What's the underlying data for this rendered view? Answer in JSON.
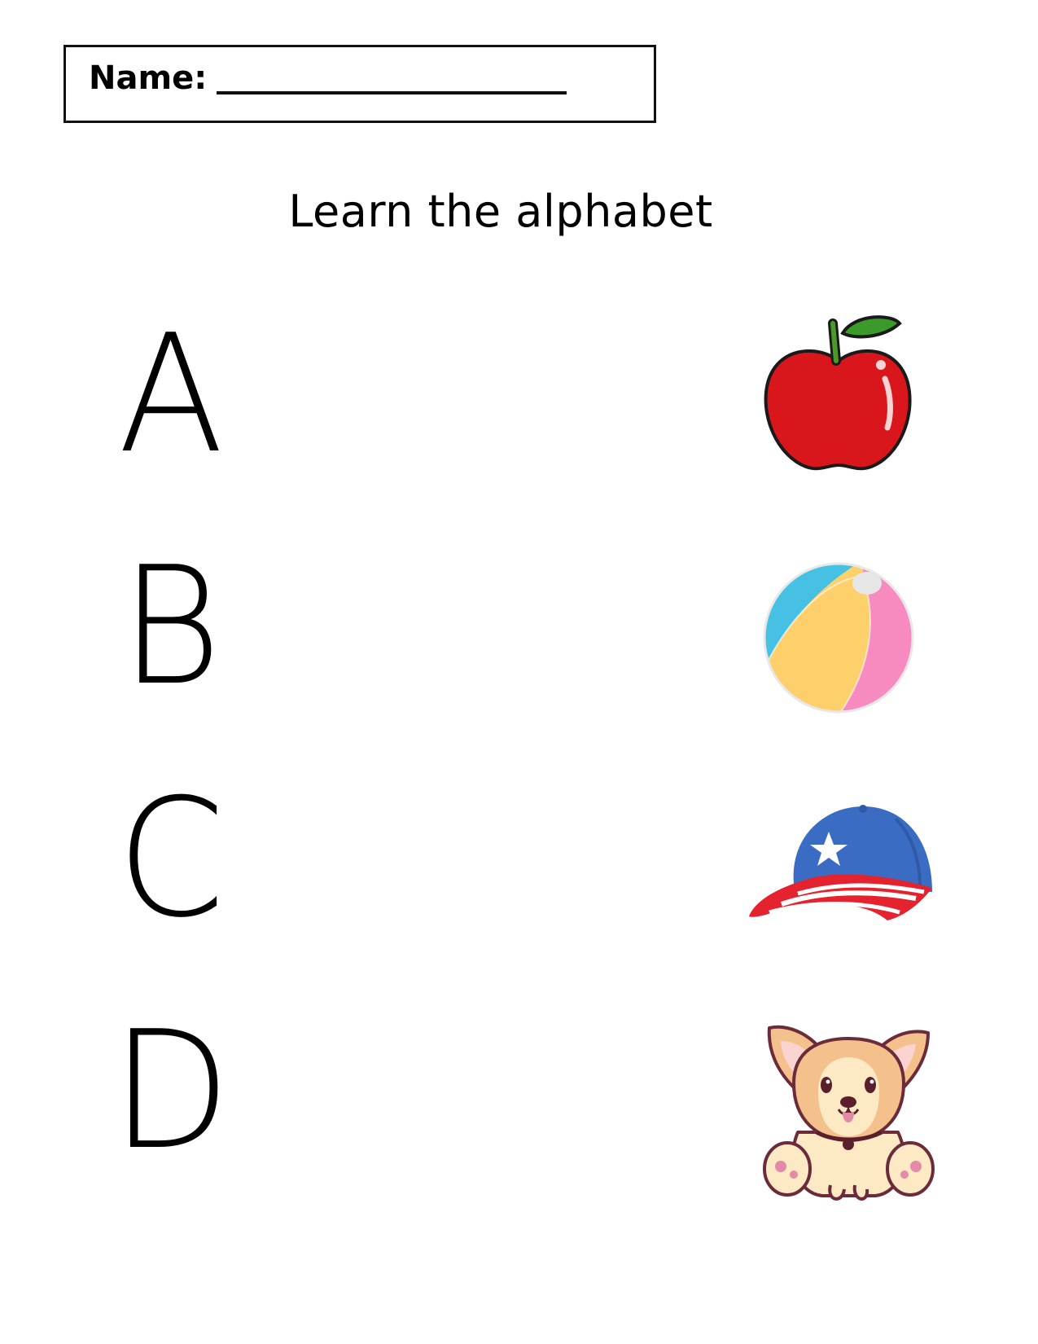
{
  "header": {
    "name_label": "Name:"
  },
  "title": "Learn the alphabet",
  "rows": [
    {
      "letter": "A",
      "icon": "apple-icon"
    },
    {
      "letter": "B",
      "icon": "beach-ball-icon"
    },
    {
      "letter": "C",
      "icon": "cap-icon"
    },
    {
      "letter": "D",
      "icon": "dog-icon"
    }
  ],
  "colors": {
    "apple_red": "#d9161b",
    "leaf_green": "#3a9a2a",
    "ball_blue": "#46c1e3",
    "ball_yellow": "#fdd06b",
    "ball_pink": "#f78bbf",
    "cap_blue": "#3a6cc4",
    "cap_red": "#e5232f",
    "dog_tan": "#f4c08c",
    "dog_cream": "#fde9c4"
  }
}
